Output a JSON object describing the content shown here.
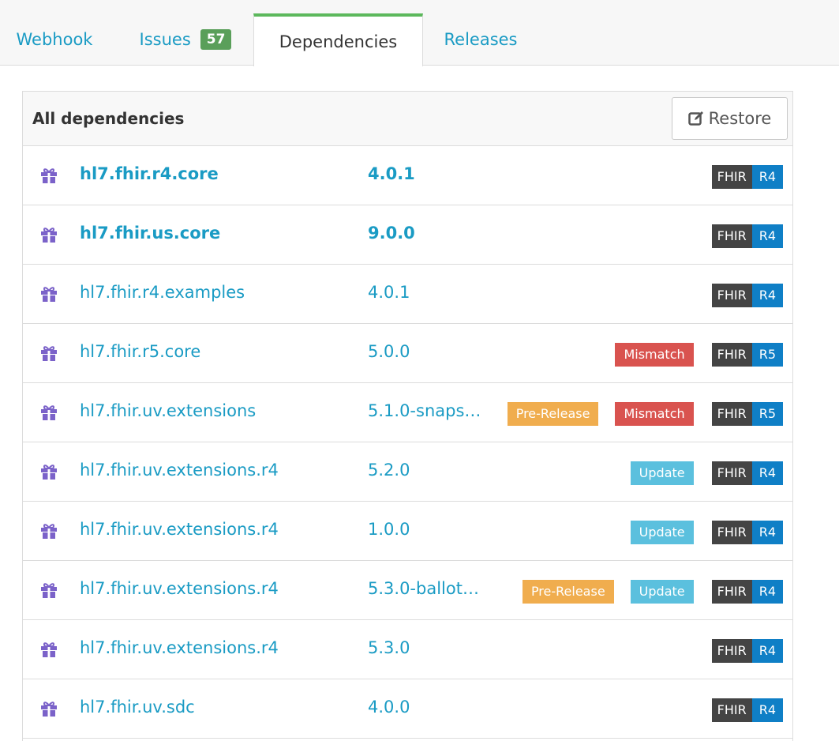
{
  "tabs": {
    "webhook": "Webhook",
    "issues": "Issues",
    "issues_count": "57",
    "dependencies": "Dependencies",
    "releases": "Releases"
  },
  "panel": {
    "title": "All dependencies",
    "restore_label": "Restore"
  },
  "rows": [
    {
      "name": "hl7.fhir.r4.core",
      "version": "4.0.1",
      "bold": true,
      "badges": [],
      "fhir": "FHIR",
      "release": "R4"
    },
    {
      "name": "hl7.fhir.us.core",
      "version": "9.0.0",
      "bold": true,
      "badges": [],
      "fhir": "FHIR",
      "release": "R4"
    },
    {
      "name": "hl7.fhir.r4.examples",
      "version": "4.0.1",
      "bold": false,
      "badges": [],
      "fhir": "FHIR",
      "release": "R4"
    },
    {
      "name": "hl7.fhir.r5.core",
      "version": "5.0.0",
      "bold": false,
      "badges": [
        "Mismatch"
      ],
      "fhir": "FHIR",
      "release": "R5"
    },
    {
      "name": "hl7.fhir.uv.extensions",
      "version": "5.1.0-snaps…",
      "bold": false,
      "badges": [
        "Pre-Release",
        "Mismatch"
      ],
      "fhir": "FHIR",
      "release": "R5"
    },
    {
      "name": "hl7.fhir.uv.extensions.r4",
      "version": "5.2.0",
      "bold": false,
      "badges": [
        "Update"
      ],
      "fhir": "FHIR",
      "release": "R4"
    },
    {
      "name": "hl7.fhir.uv.extensions.r4",
      "version": "1.0.0",
      "bold": false,
      "badges": [
        "Update"
      ],
      "fhir": "FHIR",
      "release": "R4"
    },
    {
      "name": "hl7.fhir.uv.extensions.r4",
      "version": "5.3.0-ballot-…",
      "bold": false,
      "badges": [
        "Pre-Release",
        "Update"
      ],
      "fhir": "FHIR",
      "release": "R4"
    },
    {
      "name": "hl7.fhir.uv.extensions.r4",
      "version": "5.3.0",
      "bold": false,
      "badges": [],
      "fhir": "FHIR",
      "release": "R4"
    },
    {
      "name": "hl7.fhir.uv.sdc",
      "version": "4.0.0",
      "bold": false,
      "badges": [],
      "fhir": "FHIR",
      "release": "R4"
    }
  ],
  "colors": {
    "link": "#1a9bc4",
    "active_tab_accent": "#5cb85c",
    "issues_badge": "#5a9f5a",
    "pre_release": "#f0ad4e",
    "mismatch": "#d9534f",
    "update": "#5bc0de",
    "fhir_dark": "#444444",
    "fhir_release": "#0f7fc6",
    "package_icon": "#7b62c9"
  },
  "icons": {
    "package": "gift-icon",
    "restore": "edit-icon"
  }
}
